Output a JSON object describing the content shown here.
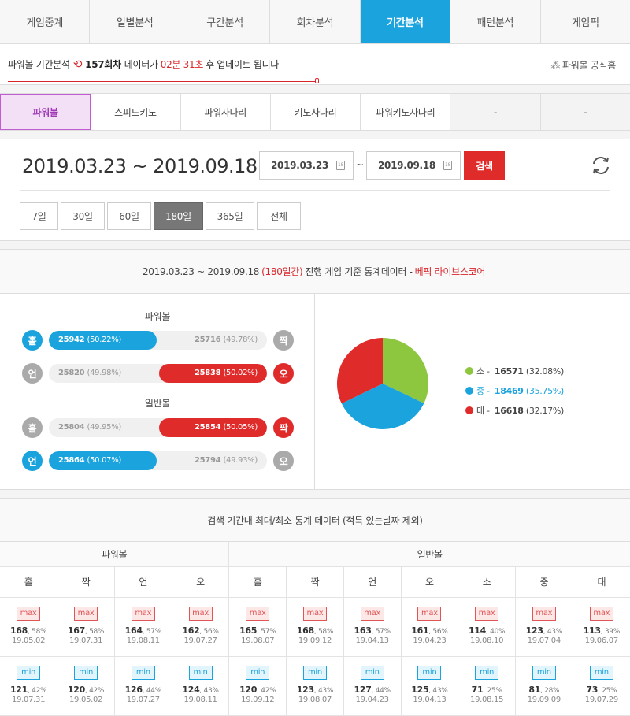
{
  "nav": {
    "tabs": [
      "게임중계",
      "일별분석",
      "구간분석",
      "회차분석",
      "기간분석",
      "패턴분석",
      "게임픽"
    ],
    "active": 4
  },
  "info": {
    "prefix": "파워볼 기간분석",
    "round": "157회차",
    "mid": "데이터가",
    "countdown": "02분 31초",
    "suffix": "후 업데이트 됩니다",
    "homepage": "파워볼 공식홈",
    "progress_pct": 49
  },
  "subnav": {
    "tabs": [
      "파워볼",
      "스피드키노",
      "파워사다리",
      "키노사다리",
      "파워키노사다리",
      "-",
      "-"
    ]
  },
  "search": {
    "range_text": "2019.03.23 ~ 2019.09.18",
    "from": "2019.03.23",
    "to": "2019.09.18",
    "tilde": "~",
    "button": "검색",
    "cal_icon": "18",
    "periods": [
      "7일",
      "30일",
      "60일",
      "180일",
      "365일",
      "전체"
    ]
  },
  "stats": {
    "head_range": "2019.03.23 ~ 2019.09.18",
    "head_days": "(180일간)",
    "head_mid": "진행 게임 기준 통계데이터 -",
    "head_source": "베픽 라이브스코어",
    "power_title": "파워볼",
    "normal_title": "일반볼",
    "rows": [
      {
        "l": "홀",
        "r": "짝",
        "lv": "25942",
        "lp": "(50.22%)",
        "rv": "25716",
        "rp": "(49.78%)",
        "win": "l",
        "lc": "blue",
        "rc": "gray",
        "frac": 0.5022
      },
      {
        "l": "언",
        "r": "오",
        "lv": "25820",
        "lp": "(49.98%)",
        "rv": "25838",
        "rp": "(50.02%)",
        "win": "r",
        "lc": "gray",
        "rc": "red",
        "frac": 0.5002
      },
      {
        "l": "홀",
        "r": "짝",
        "lv": "25804",
        "lp": "(49.95%)",
        "rv": "25854",
        "rp": "(50.05%)",
        "win": "r",
        "lc": "gray",
        "rc": "red",
        "frac": 0.5005
      },
      {
        "l": "언",
        "r": "오",
        "lv": "25864",
        "lp": "(50.07%)",
        "rv": "25794",
        "rp": "(49.93%)",
        "win": "l",
        "lc": "blue",
        "rc": "gray",
        "frac": 0.5007
      }
    ],
    "pie": [
      {
        "label": "소",
        "value": 16571,
        "pct": "(32.08%)",
        "color": "#8dc63f"
      },
      {
        "label": "중",
        "value": 18469,
        "pct": "(35.75%)",
        "color": "#1aa3dc"
      },
      {
        "label": "대",
        "value": 16618,
        "pct": "(32.17%)",
        "color": "#e02b2b"
      }
    ]
  },
  "minmax": {
    "title": "검색 기간내 최대/최소 통계 데이터 (적특 있는날짜 제외)",
    "groups": [
      "파워볼",
      "일반볼"
    ],
    "cols": [
      "홀",
      "짝",
      "언",
      "오",
      "홀",
      "짝",
      "언",
      "오",
      "소",
      "중",
      "대"
    ],
    "max_label": "max",
    "min_label": "min",
    "max": [
      {
        "n": "168",
        "p": ", 58%",
        "d": "19.05.02"
      },
      {
        "n": "167",
        "p": ", 58%",
        "d": "19.07.31"
      },
      {
        "n": "164",
        "p": ", 57%",
        "d": "19.08.11"
      },
      {
        "n": "162",
        "p": ", 56%",
        "d": "19.07.27"
      },
      {
        "n": "165",
        "p": ", 57%",
        "d": "19.08.07"
      },
      {
        "n": "168",
        "p": ", 58%",
        "d": "19.09.12"
      },
      {
        "n": "163",
        "p": ", 57%",
        "d": "19.04.13"
      },
      {
        "n": "161",
        "p": ", 56%",
        "d": "19.04.23"
      },
      {
        "n": "114",
        "p": ", 40%",
        "d": "19.08.10"
      },
      {
        "n": "123",
        "p": ", 43%",
        "d": "19.07.04"
      },
      {
        "n": "113",
        "p": ", 39%",
        "d": "19.06.07"
      }
    ],
    "min": [
      {
        "n": "121",
        "p": ", 42%",
        "d": "19.07.31"
      },
      {
        "n": "120",
        "p": ", 42%",
        "d": "19.05.02"
      },
      {
        "n": "126",
        "p": ", 44%",
        "d": "19.07.27"
      },
      {
        "n": "124",
        "p": ", 43%",
        "d": "19.08.11"
      },
      {
        "n": "120",
        "p": ", 42%",
        "d": "19.09.12"
      },
      {
        "n": "123",
        "p": ", 43%",
        "d": "19.08.07"
      },
      {
        "n": "127",
        "p": ", 44%",
        "d": "19.04.23"
      },
      {
        "n": "125",
        "p": ", 43%",
        "d": "19.04.13"
      },
      {
        "n": "71",
        "p": ", 25%",
        "d": "19.08.15"
      },
      {
        "n": "81",
        "p": ", 28%",
        "d": "19.09.09"
      },
      {
        "n": "73",
        "p": ", 25%",
        "d": "19.07.29"
      }
    ]
  }
}
